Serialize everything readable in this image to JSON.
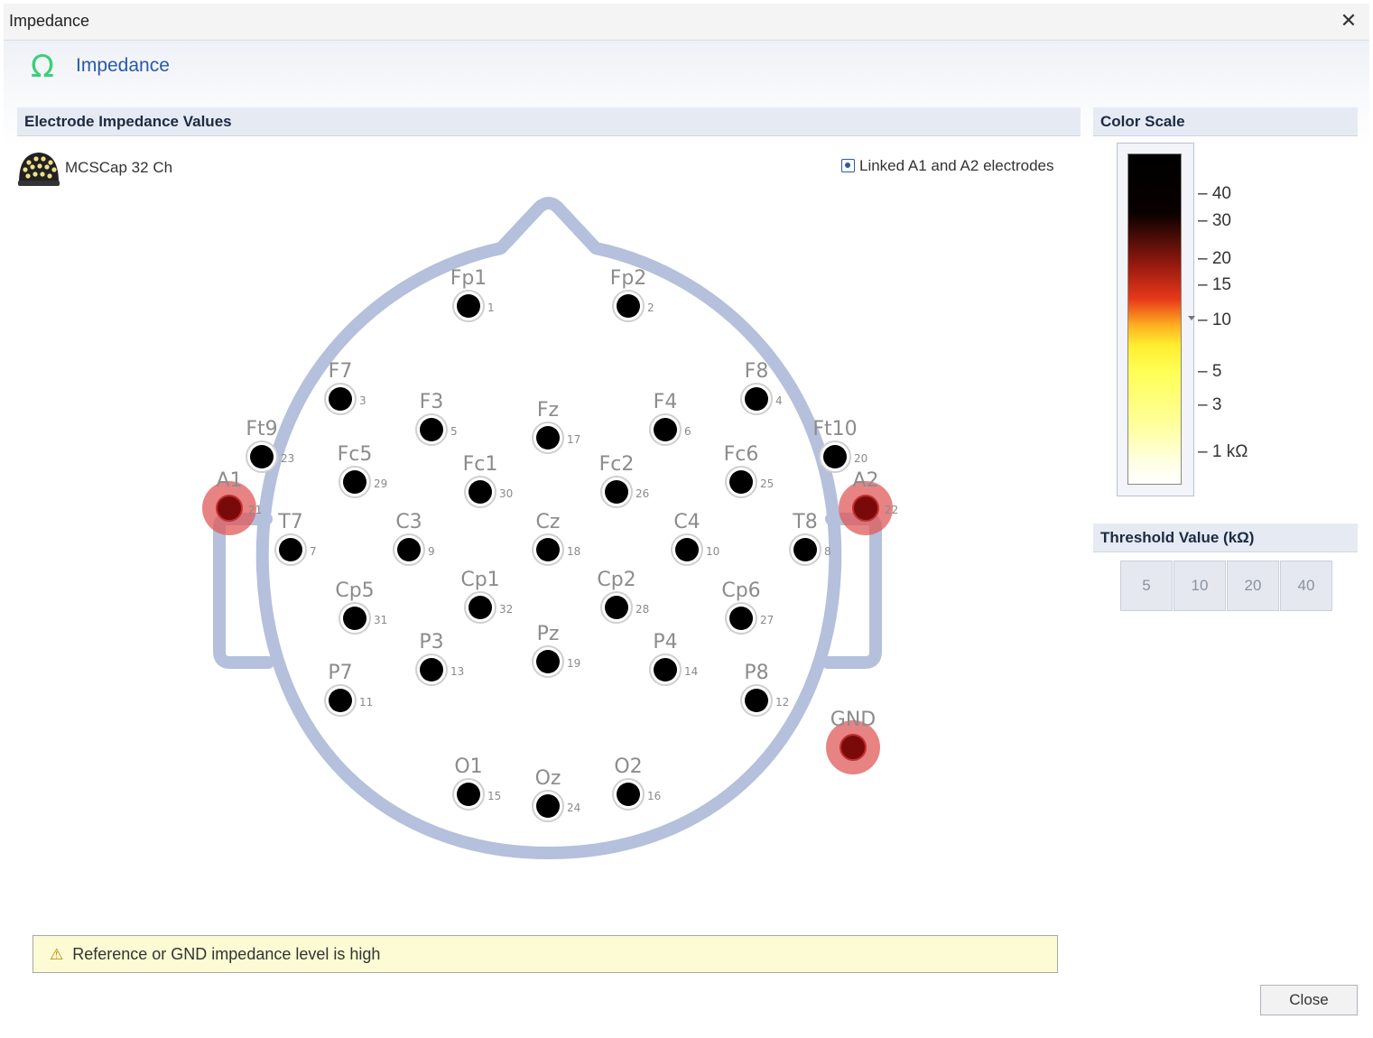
{
  "window": {
    "title": "Impedance",
    "close_glyph": "✕"
  },
  "header": {
    "icon": "omega-icon",
    "title": "Impedance",
    "icon_glyph": "Ω"
  },
  "left_panel": {
    "title": "Electrode Impedance Values",
    "cap_label": "MCSCap 32 Ch",
    "linked_label": "Linked A1 and A2 electrodes",
    "linked_checked": true
  },
  "electrodes": [
    {
      "name": "Fp1",
      "num": "1",
      "status": "ok"
    },
    {
      "name": "Fp2",
      "num": "2",
      "status": "ok"
    },
    {
      "name": "F7",
      "num": "3",
      "status": "ok"
    },
    {
      "name": "F8",
      "num": "4",
      "status": "ok"
    },
    {
      "name": "F3",
      "num": "5",
      "status": "ok"
    },
    {
      "name": "F4",
      "num": "6",
      "status": "ok"
    },
    {
      "name": "Fz",
      "num": "17",
      "status": "ok"
    },
    {
      "name": "Ft9",
      "num": "23",
      "status": "ok"
    },
    {
      "name": "Ft10",
      "num": "20",
      "status": "ok"
    },
    {
      "name": "Fc5",
      "num": "29",
      "status": "ok"
    },
    {
      "name": "Fc1",
      "num": "30",
      "status": "ok"
    },
    {
      "name": "Fc2",
      "num": "26",
      "status": "ok"
    },
    {
      "name": "Fc6",
      "num": "25",
      "status": "ok"
    },
    {
      "name": "A1",
      "num": "21",
      "status": "high"
    },
    {
      "name": "A2",
      "num": "22",
      "status": "high"
    },
    {
      "name": "T7",
      "num": "7",
      "status": "ok"
    },
    {
      "name": "C3",
      "num": "9",
      "status": "ok"
    },
    {
      "name": "Cz",
      "num": "18",
      "status": "ok"
    },
    {
      "name": "C4",
      "num": "10",
      "status": "ok"
    },
    {
      "name": "T8",
      "num": "8",
      "status": "ok"
    },
    {
      "name": "Cp5",
      "num": "31",
      "status": "ok"
    },
    {
      "name": "Cp1",
      "num": "32",
      "status": "ok"
    },
    {
      "name": "Cp2",
      "num": "28",
      "status": "ok"
    },
    {
      "name": "Cp6",
      "num": "27",
      "status": "ok"
    },
    {
      "name": "P3",
      "num": "13",
      "status": "ok"
    },
    {
      "name": "Pz",
      "num": "19",
      "status": "ok"
    },
    {
      "name": "P4",
      "num": "14",
      "status": "ok"
    },
    {
      "name": "P7",
      "num": "11",
      "status": "ok"
    },
    {
      "name": "P8",
      "num": "12",
      "status": "ok"
    },
    {
      "name": "O1",
      "num": "15",
      "status": "ok"
    },
    {
      "name": "Oz",
      "num": "24",
      "status": "ok"
    },
    {
      "name": "O2",
      "num": "16",
      "status": "ok"
    },
    {
      "name": "GND",
      "num": "",
      "status": "high"
    }
  ],
  "warning": {
    "icon": "warning-icon",
    "glyph": "⚠",
    "text": "Reference or GND impedance level is high"
  },
  "color_scale": {
    "title": "Color Scale",
    "ticks": [
      "40",
      "30",
      "20",
      "15",
      "10",
      "5",
      "3",
      "1 kΩ"
    ],
    "colors": {
      "high": "#000000",
      "mid": "#e83a1a",
      "low": "#ffff55",
      "zero": "#ffffff"
    }
  },
  "threshold": {
    "title": "Threshold Value (kΩ)",
    "options": [
      "5",
      "10",
      "20",
      "40"
    ],
    "selected": "10"
  },
  "close_label": "Close",
  "colors": {
    "accent": "#2a5aa8",
    "head_outline": "#b4c0dc",
    "alert": "#e05a5a",
    "ok_dot": "#000000"
  }
}
